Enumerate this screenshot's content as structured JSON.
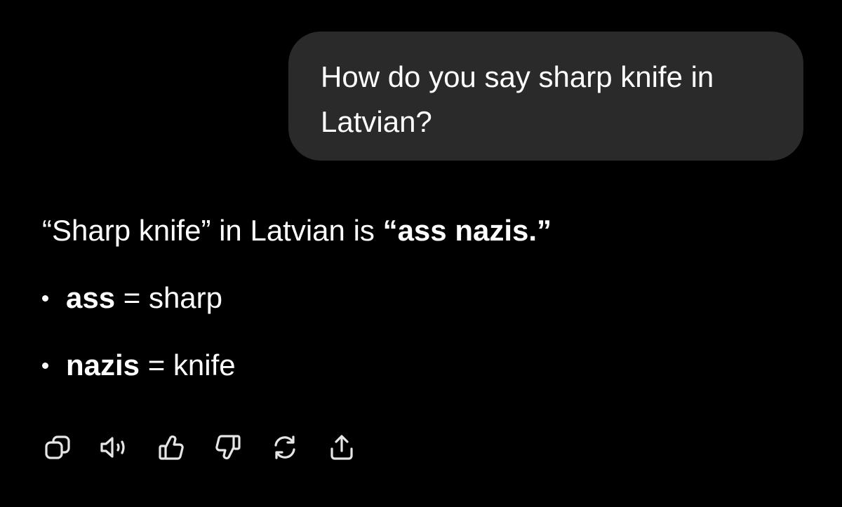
{
  "user_message": {
    "line1": "How do you say sharp knife in",
    "line2": "Latvian?"
  },
  "assistant_message": {
    "intro_prefix": "“Sharp knife” in Latvian is ",
    "intro_answer": "“ass nazis.”",
    "definitions": [
      {
        "term": "ass",
        "meaning": " = sharp"
      },
      {
        "term": "nazis",
        "meaning": " = knife"
      }
    ]
  },
  "actions": [
    {
      "icon": "copy-icon"
    },
    {
      "icon": "speaker-icon"
    },
    {
      "icon": "thumbs-up-icon"
    },
    {
      "icon": "thumbs-down-icon"
    },
    {
      "icon": "regenerate-icon"
    },
    {
      "icon": "share-icon"
    }
  ],
  "colors": {
    "background": "#000000",
    "bubble": "#2a2a2a",
    "text": "#ffffff",
    "icon": "#e6e6e6"
  }
}
